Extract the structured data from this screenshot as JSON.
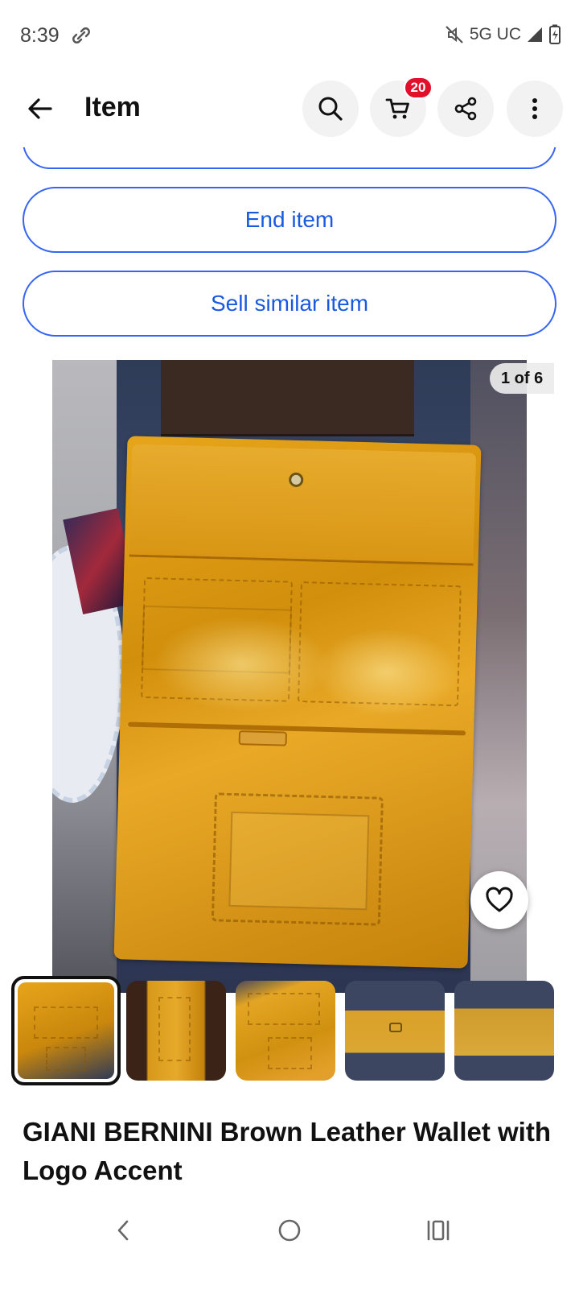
{
  "status_bar": {
    "time": "8:39",
    "network": "5G UC",
    "icons": [
      "link-icon",
      "mute-icon",
      "signal-icon",
      "battery-charging-icon"
    ]
  },
  "header": {
    "title": "Item",
    "back_icon": "arrow-left-icon",
    "actions": [
      "search-icon",
      "cart-icon",
      "share-icon",
      "more-vertical-icon"
    ],
    "cart_count": "20"
  },
  "actions": {
    "end_item": "End item",
    "sell_similar": "Sell similar item"
  },
  "gallery": {
    "counter": "1 of 6",
    "thumbnail_count": 5,
    "selected_index": 0,
    "favorite_icon": "heart-outline-icon"
  },
  "item": {
    "title": "GIANI BERNINI Brown Leather Wallet with Logo Accent"
  },
  "colors": {
    "accent_blue": "#3665f3",
    "link_text": "#1a5adf",
    "badge_red": "#e0102a"
  },
  "nav_bar": {
    "icons": [
      "nav-back-icon",
      "nav-home-icon",
      "nav-recents-icon"
    ]
  }
}
